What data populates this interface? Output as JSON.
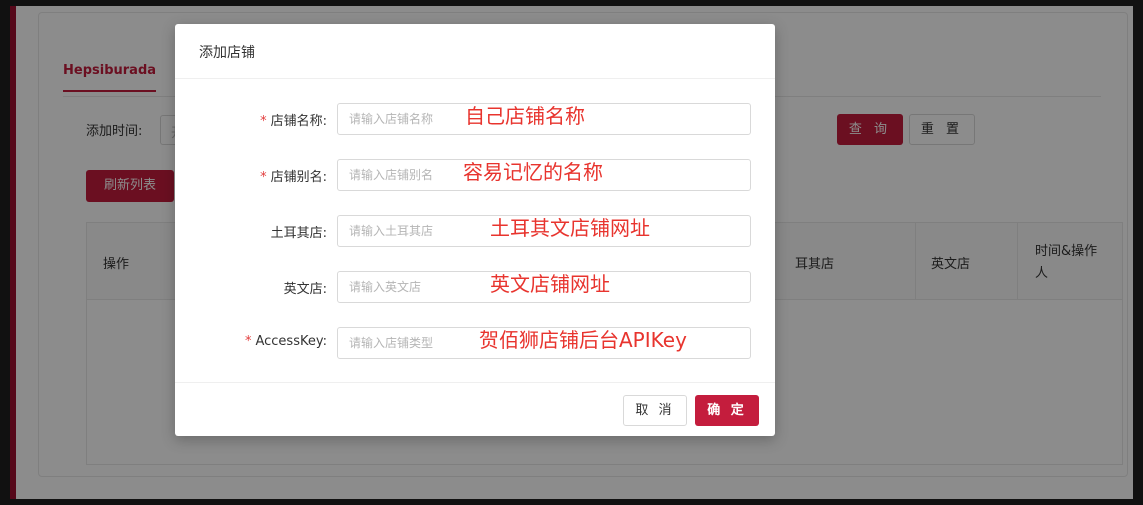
{
  "background": {
    "tab_label": "Hepsiburada",
    "filter": {
      "label": "添加时间:",
      "placeholder": "开始"
    },
    "buttons": {
      "query": "查 询",
      "reset": "重 置",
      "refresh": "刷新列表"
    },
    "table": {
      "headers": {
        "action": "操作",
        "turkey_store": "耳其店",
        "english_store": "英文店",
        "time_operator": "时间&操作人"
      }
    }
  },
  "modal": {
    "title": "添加店铺",
    "fields": [
      {
        "label": "店铺名称",
        "required": true,
        "placeholder": "请输入店铺名称",
        "annotation": "自己店铺名称"
      },
      {
        "label": "店铺别名",
        "required": true,
        "placeholder": "请输入店铺别名",
        "annotation": "容易记忆的名称"
      },
      {
        "label": "土耳其店",
        "required": false,
        "placeholder": "请输入土耳其店",
        "annotation": "土耳其文店铺网址"
      },
      {
        "label": "英文店",
        "required": false,
        "placeholder": "请输入英文店",
        "annotation": "英文店铺网址"
      },
      {
        "label": "AccessKey",
        "required": true,
        "placeholder": "请输入店铺类型",
        "annotation": "贺佰狮店铺后台APIKey"
      }
    ],
    "colon": ":",
    "required_mark": "*",
    "buttons": {
      "cancel": "取 消",
      "ok": "确 定"
    }
  },
  "colors": {
    "primary": "#c41d3d",
    "annotation": "#e8342e",
    "overlay": "rgba(0,0,0,0.45)"
  }
}
